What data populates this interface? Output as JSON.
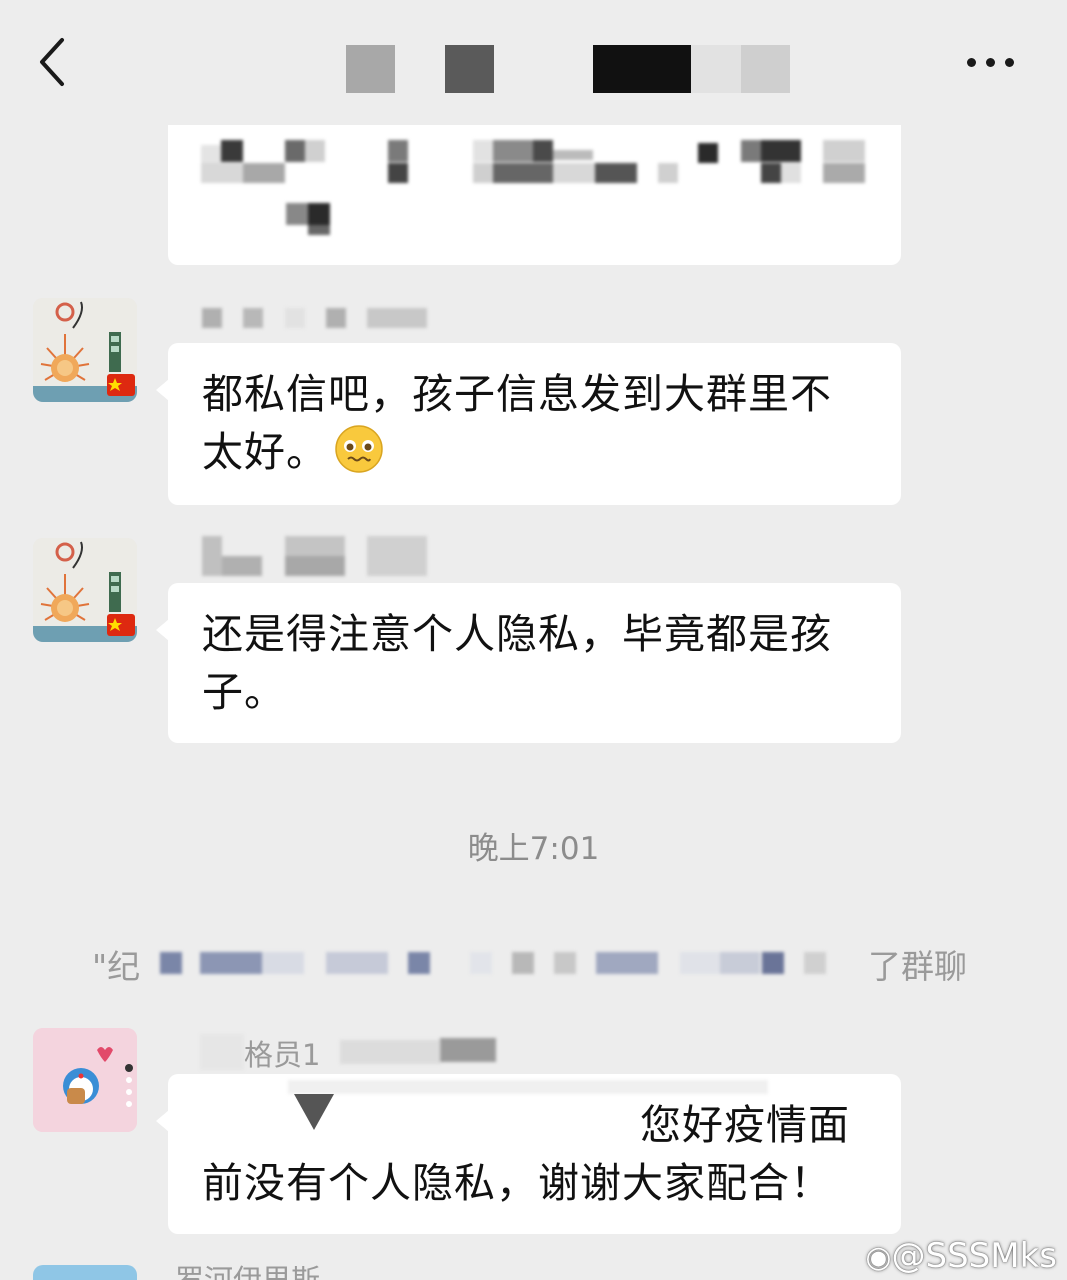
{
  "header": {
    "back_icon": "chevron-left-icon",
    "more_icon": "more-dots-icon"
  },
  "messages": [
    {
      "id": "msg2",
      "text": "都私信吧，孩子信息发到大群里不太好。",
      "emoji": "pleading-face-emoji"
    },
    {
      "id": "msg3",
      "text": "还是得注意个人隐私，毕竟都是孩子。"
    },
    {
      "id": "msg4",
      "text": "您好疫情面前没有个人隐私，谢谢大家配合！"
    }
  ],
  "sender4_name_fragment": "格员1",
  "system": {
    "time": "晚上7:01",
    "join_prefix": "\"纪",
    "join_suffix": "了群聊"
  },
  "last_sender_fragment": "罗河伊里斯",
  "watermark": "@SSSMks",
  "colors": {
    "background": "#ededed",
    "bubble": "#ffffff",
    "system_text": "#9a9a9a"
  }
}
